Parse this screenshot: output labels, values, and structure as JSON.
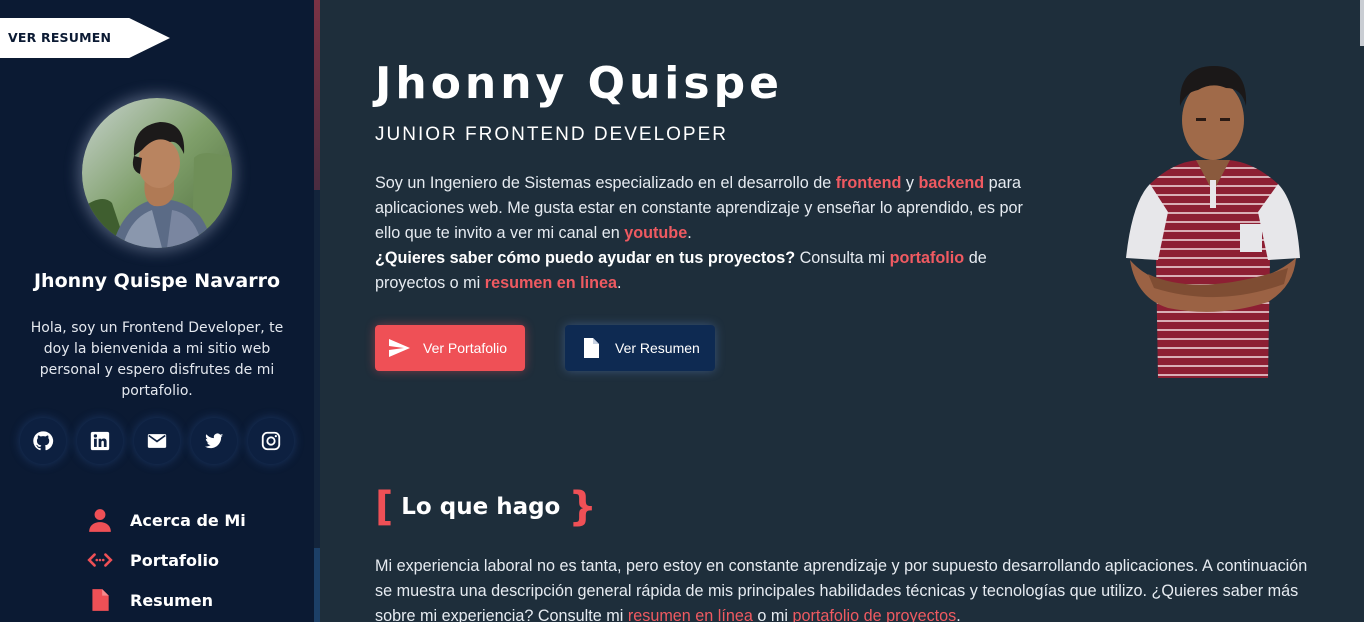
{
  "sidebar": {
    "resume_tab": "VER RESUMEN",
    "name": "Jhonny Quispe Navarro",
    "bio": "Hola, soy un Frontend Developer, te doy la bienvenida a mi sitio web personal y espero disfrutes de mi portafolio.",
    "socials": [
      {
        "icon": "github-icon"
      },
      {
        "icon": "linkedin-icon"
      },
      {
        "icon": "mail-icon"
      },
      {
        "icon": "twitter-icon"
      },
      {
        "icon": "instagram-icon"
      }
    ],
    "nav": [
      {
        "label": "Acerca de Mi",
        "icon": "user-icon"
      },
      {
        "label": "Portafolio",
        "icon": "code-icon"
      },
      {
        "label": "Resumen",
        "icon": "file-icon"
      }
    ]
  },
  "hero": {
    "name": "Jhonny Quispe",
    "role": "JUNIOR FRONTEND DEVELOPER",
    "text": {
      "p1": "Soy un Ingeniero de Sistemas especializado en el desarrollo de ",
      "frontend": "frontend",
      "p2": " y ",
      "backend": "backend",
      "p3": " para aplicaciones web. Me gusta estar en constante aprendizaje y enseñar lo aprendido, es por ello que te invito a ver mi canal en ",
      "youtube": "youtube",
      "p4": ".",
      "question": "¿Quieres saber cómo puedo ayudar en tus proyectos?",
      "p5": " Consulta mi ",
      "portafolio": "portafolio",
      "p6": " de proyectos o mi ",
      "resumen": "resumen en linea",
      "p7": "."
    },
    "buttons": {
      "portfolio": "Ver Portafolio",
      "resumen": "Ver Resumen"
    }
  },
  "what_i_do": {
    "open_bracket": "[",
    "title": "Lo que hago",
    "close_bracket": "}",
    "text": {
      "p1": "Mi experiencia laboral no es tanta, pero estoy en constante aprendizaje y por supuesto desarrollando aplicaciones. A continuación se muestra una descripción general rápida de mis principales habilidades técnicas y tecnologías que utilizo. ¿Quieres saber más sobre mi experiencia? Consulte mi ",
      "resumen": "resumen en línea",
      "p2": " o mi ",
      "portafolio": "portafolio de proyectos",
      "p3": "."
    }
  },
  "colors": {
    "accent": "#ef5056",
    "sidebar_bg": "#0b1a33",
    "main_bg": "#1e2e3b",
    "button_secondary": "#0e2a52"
  }
}
